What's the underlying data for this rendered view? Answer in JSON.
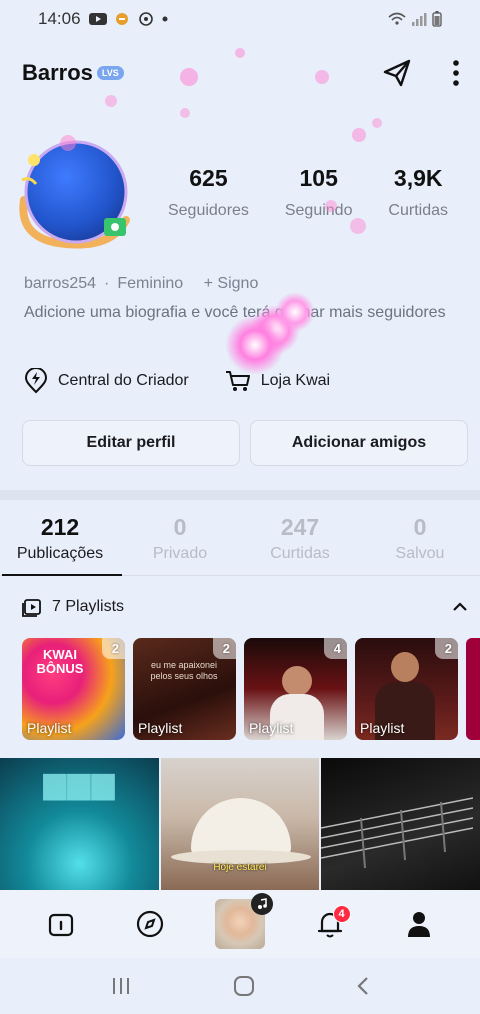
{
  "status_bar": {
    "time": "14:06",
    "icons": [
      "youtube-icon",
      "app-icon",
      "whatsapp-icon",
      "dot-icon"
    ],
    "right_icons": [
      "wifi-icon",
      "signal-icon",
      "battery-icon"
    ]
  },
  "profile": {
    "username": "Barros",
    "badge": "LVS",
    "stats": [
      {
        "value": "625",
        "label": "Seguidores"
      },
      {
        "value": "105",
        "label": "Seguindo"
      },
      {
        "value": "3,9K",
        "label": "Curtidas"
      }
    ],
    "handle": "barros254",
    "gender": "Feminino",
    "sign": "+ Signo",
    "bio": "Adicione uma biografia e você terá ganhar mais seguidores"
  },
  "links": {
    "creator_center": "Central do Criador",
    "shop": "Loja Kwai"
  },
  "actions": {
    "edit_profile": "Editar perfil",
    "add_friends": "Adicionar amigos"
  },
  "tabs": [
    {
      "count": "212",
      "label": "Publicações",
      "active": true
    },
    {
      "count": "0",
      "label": "Privado",
      "active": false
    },
    {
      "count": "247",
      "label": "Curtidas",
      "active": false
    },
    {
      "count": "0",
      "label": "Salvou",
      "active": false
    }
  ],
  "playlists": {
    "header": "7 Playlists",
    "items": [
      {
        "count": "2",
        "label": "Playlist",
        "overlay_text": "KWAI BÔNUS",
        "color": "#f6a21a"
      },
      {
        "count": "2",
        "label": "Playlist",
        "overlay_text": "eu me apaixonei pelos seus olhos",
        "color": "#3b1a15"
      },
      {
        "count": "4",
        "label": "Playlist",
        "overlay_text": "",
        "color": "#5a1012"
      },
      {
        "count": "2",
        "label": "Playlist",
        "overlay_text": "",
        "color": "#4a1617"
      }
    ]
  },
  "grid": [
    {
      "caption": "",
      "color": "#0f5a6d"
    },
    {
      "caption": "Hoje estarei",
      "color": "#b7aba3"
    },
    {
      "caption": "",
      "color": "#1d1d1d"
    }
  ],
  "bottom_nav": {
    "items": [
      "home-icon",
      "discover-icon",
      "music-avatar",
      "notifications-icon",
      "profile-icon"
    ],
    "notification_count": "4"
  },
  "colors": {
    "accent": "#ff2b43",
    "background": "#e8eefa",
    "badge": "#7aa5ef"
  }
}
